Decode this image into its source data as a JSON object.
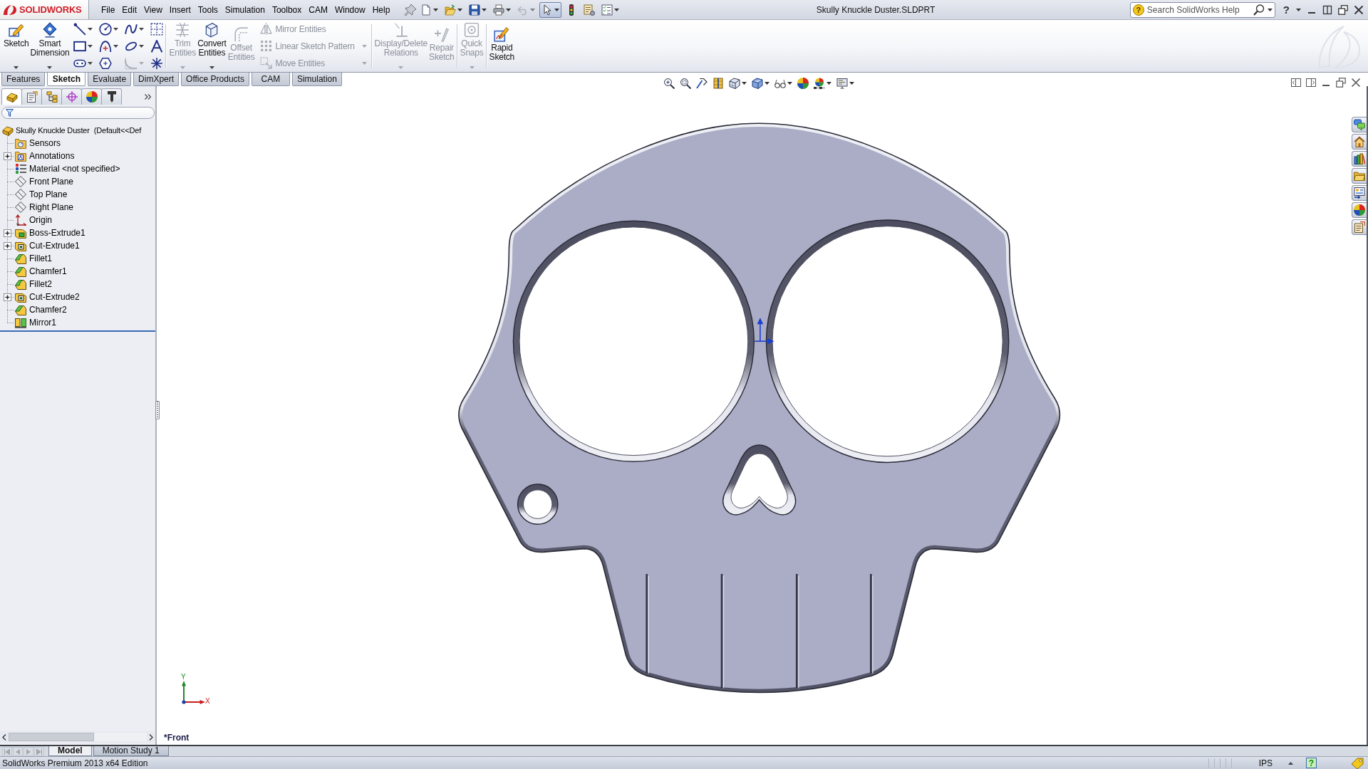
{
  "app": {
    "logo": "SOLIDWORKS"
  },
  "menu": [
    "File",
    "Edit",
    "View",
    "Insert",
    "Tools",
    "Simulation",
    "Toolbox",
    "CAM",
    "Window",
    "Help"
  ],
  "quick_access": [
    {
      "dropdown": true,
      "disabled": false,
      "selected": false
    },
    {
      "dropdown": true,
      "disabled": false,
      "selected": false
    },
    {
      "dropdown": true,
      "disabled": false,
      "selected": false
    },
    {
      "dropdown": true,
      "disabled": false,
      "selected": false
    },
    {
      "dropdown": true,
      "disabled": true,
      "selected": false
    },
    {
      "dropdown": true,
      "disabled": false,
      "selected": true
    },
    {
      "dropdown": false,
      "disabled": false,
      "selected": false
    },
    {
      "dropdown": false,
      "disabled": false,
      "selected": false
    },
    {
      "dropdown": true,
      "disabled": false,
      "selected": false
    }
  ],
  "window": {
    "title": "Skully Knuckle Duster.SLDPRT"
  },
  "search": {
    "badge": "?",
    "placeholder": "Search SolidWorks Help"
  },
  "help_button": {
    "label": "?"
  },
  "ribbon": {
    "main_buttons": [
      {
        "label": "Sketch",
        "dropdown": true,
        "disabled": false
      },
      {
        "label": "Smart Dimension",
        "dropdown": true,
        "disabled": false
      }
    ],
    "sketch_tools": [
      {
        "dropdown": true,
        "disabled": false
      },
      {
        "dropdown": true,
        "disabled": false
      },
      {
        "dropdown": true,
        "disabled": false
      },
      {
        "dropdown": false,
        "disabled": false
      },
      {
        "dropdown": true,
        "disabled": false
      },
      {
        "dropdown": true,
        "disabled": false
      },
      {
        "dropdown": true,
        "disabled": false
      },
      {
        "dropdown": false,
        "disabled": false
      },
      {
        "dropdown": true,
        "disabled": false
      },
      {
        "dropdown": false,
        "disabled": false
      },
      {
        "dropdown": true,
        "disabled": true
      },
      {
        "dropdown": false,
        "disabled": false
      }
    ],
    "edit_buttons": [
      {
        "label": "Trim Entities",
        "dropdown": true,
        "disabled": true
      },
      {
        "label": "Convert Entities",
        "dropdown": true,
        "disabled": false
      },
      {
        "label": "Offset Entities",
        "dropdown": false,
        "disabled": true
      }
    ],
    "entity_commands": [
      {
        "label": "Mirror Entities",
        "dropdown": false,
        "disabled": true
      },
      {
        "label": "Linear Sketch Pattern",
        "dropdown": true,
        "disabled": true
      },
      {
        "label": "Move Entities",
        "dropdown": true,
        "disabled": true
      }
    ],
    "relation_buttons": [
      {
        "label": "Display/Delete Relations",
        "dropdown": true,
        "disabled": true
      },
      {
        "label": "Repair Sketch",
        "dropdown": false,
        "disabled": true
      }
    ],
    "snap_buttons": [
      {
        "label": "Quick Snaps",
        "dropdown": true,
        "disabled": true
      }
    ],
    "mode_buttons": [
      {
        "label": "Rapid Sketch",
        "dropdown": false,
        "disabled": false
      }
    ]
  },
  "command_tabs": [
    {
      "label": "Features",
      "selected": false
    },
    {
      "label": "Sketch",
      "selected": true
    },
    {
      "label": "Evaluate",
      "selected": false
    },
    {
      "label": "DimXpert",
      "selected": false
    },
    {
      "label": "Office Products",
      "selected": false
    },
    {
      "label": "CAM",
      "selected": false
    },
    {
      "label": "Simulation",
      "selected": false
    }
  ],
  "view_toolbar": [
    {
      "dropdown": false
    },
    {
      "dropdown": false
    },
    {
      "dropdown": false
    },
    {
      "dropdown": false
    },
    {
      "dropdown": true
    },
    {
      "dropdown": true
    },
    {
      "dropdown": true
    },
    {
      "dropdown": false
    },
    {
      "dropdown": true
    },
    {
      "dropdown": true
    }
  ],
  "panel_tabs": [
    {
      "selected": true
    },
    {
      "selected": false
    },
    {
      "selected": false
    },
    {
      "selected": false
    },
    {
      "selected": false
    },
    {
      "selected": false
    }
  ],
  "tree": {
    "root": {
      "label": "Skully Knuckle Duster  (Default<<Def",
      "children": [
        {
          "label": "Sensors",
          "kind": "sensors",
          "has_children": false
        },
        {
          "label": "Annotations",
          "kind": "annotations",
          "has_children": true,
          "expanded": false
        },
        {
          "label": "Material <not specified>",
          "kind": "material",
          "has_children": false
        },
        {
          "label": "Front Plane",
          "kind": "plane",
          "has_children": false
        },
        {
          "label": "Top Plane",
          "kind": "plane",
          "has_children": false
        },
        {
          "label": "Right Plane",
          "kind": "plane",
          "has_children": false
        },
        {
          "label": "Origin",
          "kind": "origin",
          "has_children": false
        },
        {
          "label": "Boss-Extrude1",
          "kind": "boss_extrude",
          "has_children": true,
          "expanded": false
        },
        {
          "label": "Cut-Extrude1",
          "kind": "cut_extrude",
          "has_children": true,
          "expanded": false
        },
        {
          "label": "Fillet1",
          "kind": "fillet",
          "has_children": false
        },
        {
          "label": "Chamfer1",
          "kind": "chamfer",
          "has_children": false
        },
        {
          "label": "Fillet2",
          "kind": "fillet",
          "has_children": false
        },
        {
          "label": "Cut-Extrude2",
          "kind": "cut_extrude",
          "has_children": true,
          "expanded": false
        },
        {
          "label": "Chamfer2",
          "kind": "chamfer",
          "has_children": false
        },
        {
          "label": "Mirror1",
          "kind": "mirror",
          "has_children": false
        }
      ]
    }
  },
  "viewport": {
    "view_name": "*Front",
    "triad": {
      "x_label": "X",
      "y_label": "Y"
    }
  },
  "model_tabs": [
    {
      "label": "Model",
      "selected": true
    },
    {
      "label": "Motion Study 1",
      "selected": false
    }
  ],
  "nav_buttons": [
    {
      "disabled": true
    },
    {
      "disabled": true
    },
    {
      "disabled": true
    },
    {
      "disabled": true
    }
  ],
  "status_bar": {
    "text": "SolidWorks Premium 2013 x64 Edition",
    "units": "IPS",
    "help": "?"
  }
}
